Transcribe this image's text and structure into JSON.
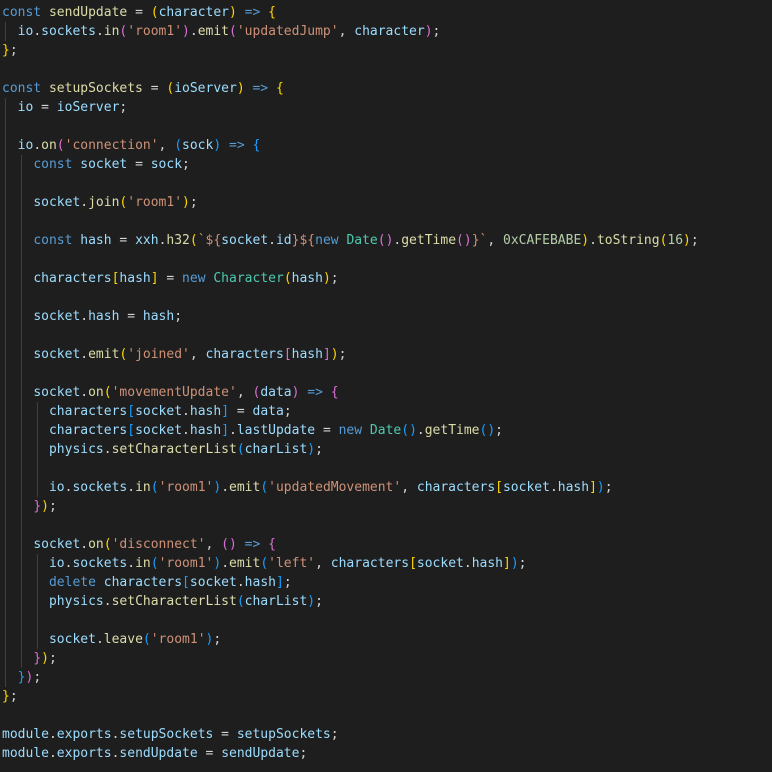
{
  "colors": {
    "background": "#1e1e1e",
    "text": "#d4d4d4",
    "keyword": "#569cd6",
    "function": "#dcdcaa",
    "variable": "#9cdcfe",
    "string": "#ce9178",
    "number": "#b5cea8",
    "class": "#4ec9b0",
    "control": "#c586c0",
    "bracket1": "#ffd700",
    "bracket2": "#da70d6",
    "bracket3": "#179fff"
  },
  "code": {
    "lines": [
      [
        [
          "kw",
          "const"
        ],
        [
          "p",
          " "
        ],
        [
          "def",
          "sendUpdate"
        ],
        [
          "p",
          " = "
        ],
        [
          "b1",
          "("
        ],
        [
          "var",
          "character"
        ],
        [
          "b1",
          ")"
        ],
        [
          "p",
          " "
        ],
        [
          "kw",
          "=>"
        ],
        [
          "p",
          " "
        ],
        [
          "b1",
          "{"
        ]
      ],
      [
        [
          "p",
          "  "
        ],
        [
          "var",
          "io"
        ],
        [
          "p",
          "."
        ],
        [
          "var",
          "sockets"
        ],
        [
          "p",
          "."
        ],
        [
          "def",
          "in"
        ],
        [
          "b2",
          "("
        ],
        [
          "str",
          "'room1'"
        ],
        [
          "b2",
          ")"
        ],
        [
          "p",
          "."
        ],
        [
          "def",
          "emit"
        ],
        [
          "b2",
          "("
        ],
        [
          "str",
          "'updatedJump'"
        ],
        [
          "p",
          ", "
        ],
        [
          "var",
          "character"
        ],
        [
          "b2",
          ")"
        ],
        [
          "p",
          ";"
        ]
      ],
      [
        [
          "b1",
          "}"
        ],
        [
          "p",
          ";"
        ]
      ],
      [],
      [
        [
          "kw",
          "const"
        ],
        [
          "p",
          " "
        ],
        [
          "def",
          "setupSockets"
        ],
        [
          "p",
          " = "
        ],
        [
          "b1",
          "("
        ],
        [
          "var",
          "ioServer"
        ],
        [
          "b1",
          ")"
        ],
        [
          "p",
          " "
        ],
        [
          "kw",
          "=>"
        ],
        [
          "p",
          " "
        ],
        [
          "b1",
          "{"
        ]
      ],
      [
        [
          "p",
          "  "
        ],
        [
          "var",
          "io"
        ],
        [
          "p",
          " = "
        ],
        [
          "var",
          "ioServer"
        ],
        [
          "p",
          ";"
        ]
      ],
      [],
      [
        [
          "p",
          "  "
        ],
        [
          "var",
          "io"
        ],
        [
          "p",
          "."
        ],
        [
          "def",
          "on"
        ],
        [
          "b2",
          "("
        ],
        [
          "str",
          "'connection'"
        ],
        [
          "p",
          ", "
        ],
        [
          "b3",
          "("
        ],
        [
          "var",
          "sock"
        ],
        [
          "b3",
          ")"
        ],
        [
          "p",
          " "
        ],
        [
          "kw",
          "=>"
        ],
        [
          "p",
          " "
        ],
        [
          "b3",
          "{"
        ]
      ],
      [
        [
          "p",
          "    "
        ],
        [
          "kw",
          "const"
        ],
        [
          "p",
          " "
        ],
        [
          "var",
          "socket"
        ],
        [
          "p",
          " = "
        ],
        [
          "var",
          "sock"
        ],
        [
          "p",
          ";"
        ]
      ],
      [],
      [
        [
          "p",
          "    "
        ],
        [
          "var",
          "socket"
        ],
        [
          "p",
          "."
        ],
        [
          "def",
          "join"
        ],
        [
          "b1",
          "("
        ],
        [
          "str",
          "'room1'"
        ],
        [
          "b1",
          ")"
        ],
        [
          "p",
          ";"
        ]
      ],
      [],
      [
        [
          "p",
          "    "
        ],
        [
          "kw",
          "const"
        ],
        [
          "p",
          " "
        ],
        [
          "var",
          "hash"
        ],
        [
          "p",
          " = "
        ],
        [
          "var",
          "xxh"
        ],
        [
          "p",
          "."
        ],
        [
          "def",
          "h32"
        ],
        [
          "b1",
          "("
        ],
        [
          "str",
          "`${"
        ],
        [
          "var",
          "socket"
        ],
        [
          "p",
          "."
        ],
        [
          "var",
          "id"
        ],
        [
          "str",
          "}${"
        ],
        [
          "kw",
          "new"
        ],
        [
          "p",
          " "
        ],
        [
          "cls",
          "Date"
        ],
        [
          "b2",
          "("
        ],
        [
          "b2",
          ")"
        ],
        [
          "p",
          "."
        ],
        [
          "def",
          "getTime"
        ],
        [
          "b2",
          "("
        ],
        [
          "b2",
          ")"
        ],
        [
          "str",
          "}`"
        ],
        [
          "p",
          ", "
        ],
        [
          "num",
          "0xCAFEBABE"
        ],
        [
          "b1",
          ")"
        ],
        [
          "p",
          "."
        ],
        [
          "def",
          "toString"
        ],
        [
          "b1",
          "("
        ],
        [
          "num",
          "16"
        ],
        [
          "b1",
          ")"
        ],
        [
          "p",
          ";"
        ]
      ],
      [],
      [
        [
          "p",
          "    "
        ],
        [
          "var",
          "characters"
        ],
        [
          "b1",
          "["
        ],
        [
          "var",
          "hash"
        ],
        [
          "b1",
          "]"
        ],
        [
          "p",
          " = "
        ],
        [
          "kw",
          "new"
        ],
        [
          "p",
          " "
        ],
        [
          "cls",
          "Character"
        ],
        [
          "b1",
          "("
        ],
        [
          "var",
          "hash"
        ],
        [
          "b1",
          ")"
        ],
        [
          "p",
          ";"
        ]
      ],
      [],
      [
        [
          "p",
          "    "
        ],
        [
          "var",
          "socket"
        ],
        [
          "p",
          "."
        ],
        [
          "var",
          "hash"
        ],
        [
          "p",
          " = "
        ],
        [
          "var",
          "hash"
        ],
        [
          "p",
          ";"
        ]
      ],
      [],
      [
        [
          "p",
          "    "
        ],
        [
          "var",
          "socket"
        ],
        [
          "p",
          "."
        ],
        [
          "def",
          "emit"
        ],
        [
          "b1",
          "("
        ],
        [
          "str",
          "'joined'"
        ],
        [
          "p",
          ", "
        ],
        [
          "var",
          "characters"
        ],
        [
          "b2",
          "["
        ],
        [
          "var",
          "hash"
        ],
        [
          "b2",
          "]"
        ],
        [
          "b1",
          ")"
        ],
        [
          "p",
          ";"
        ]
      ],
      [],
      [
        [
          "p",
          "    "
        ],
        [
          "var",
          "socket"
        ],
        [
          "p",
          "."
        ],
        [
          "def",
          "on"
        ],
        [
          "b1",
          "("
        ],
        [
          "str",
          "'movementUpdate'"
        ],
        [
          "p",
          ", "
        ],
        [
          "b2",
          "("
        ],
        [
          "var",
          "data"
        ],
        [
          "b2",
          ")"
        ],
        [
          "p",
          " "
        ],
        [
          "kw",
          "=>"
        ],
        [
          "p",
          " "
        ],
        [
          "b2",
          "{"
        ]
      ],
      [
        [
          "p",
          "      "
        ],
        [
          "var",
          "characters"
        ],
        [
          "b3",
          "["
        ],
        [
          "var",
          "socket"
        ],
        [
          "p",
          "."
        ],
        [
          "var",
          "hash"
        ],
        [
          "b3",
          "]"
        ],
        [
          "p",
          " = "
        ],
        [
          "var",
          "data"
        ],
        [
          "p",
          ";"
        ]
      ],
      [
        [
          "p",
          "      "
        ],
        [
          "var",
          "characters"
        ],
        [
          "b3",
          "["
        ],
        [
          "var",
          "socket"
        ],
        [
          "p",
          "."
        ],
        [
          "var",
          "hash"
        ],
        [
          "b3",
          "]"
        ],
        [
          "p",
          "."
        ],
        [
          "var",
          "lastUpdate"
        ],
        [
          "p",
          " = "
        ],
        [
          "kw",
          "new"
        ],
        [
          "p",
          " "
        ],
        [
          "cls",
          "Date"
        ],
        [
          "b3",
          "("
        ],
        [
          "b3",
          ")"
        ],
        [
          "p",
          "."
        ],
        [
          "def",
          "getTime"
        ],
        [
          "b3",
          "("
        ],
        [
          "b3",
          ")"
        ],
        [
          "p",
          ";"
        ]
      ],
      [
        [
          "p",
          "      "
        ],
        [
          "var",
          "physics"
        ],
        [
          "p",
          "."
        ],
        [
          "def",
          "setCharacterList"
        ],
        [
          "b3",
          "("
        ],
        [
          "var",
          "charList"
        ],
        [
          "b3",
          ")"
        ],
        [
          "p",
          ";"
        ]
      ],
      [],
      [
        [
          "p",
          "      "
        ],
        [
          "var",
          "io"
        ],
        [
          "p",
          "."
        ],
        [
          "var",
          "sockets"
        ],
        [
          "p",
          "."
        ],
        [
          "def",
          "in"
        ],
        [
          "b3",
          "("
        ],
        [
          "str",
          "'room1'"
        ],
        [
          "b3",
          ")"
        ],
        [
          "p",
          "."
        ],
        [
          "def",
          "emit"
        ],
        [
          "b3",
          "("
        ],
        [
          "str",
          "'updatedMovement'"
        ],
        [
          "p",
          ", "
        ],
        [
          "var",
          "characters"
        ],
        [
          "b1",
          "["
        ],
        [
          "var",
          "socket"
        ],
        [
          "p",
          "."
        ],
        [
          "var",
          "hash"
        ],
        [
          "b1",
          "]"
        ],
        [
          "b3",
          ")"
        ],
        [
          "p",
          ";"
        ]
      ],
      [
        [
          "p",
          "    "
        ],
        [
          "b2",
          "}"
        ],
        [
          "b1",
          ")"
        ],
        [
          "p",
          ";"
        ]
      ],
      [],
      [
        [
          "p",
          "    "
        ],
        [
          "var",
          "socket"
        ],
        [
          "p",
          "."
        ],
        [
          "def",
          "on"
        ],
        [
          "b1",
          "("
        ],
        [
          "str",
          "'disconnect'"
        ],
        [
          "p",
          ", "
        ],
        [
          "b2",
          "("
        ],
        [
          "b2",
          ")"
        ],
        [
          "p",
          " "
        ],
        [
          "kw",
          "=>"
        ],
        [
          "p",
          " "
        ],
        [
          "b2",
          "{"
        ]
      ],
      [
        [
          "p",
          "      "
        ],
        [
          "var",
          "io"
        ],
        [
          "p",
          "."
        ],
        [
          "var",
          "sockets"
        ],
        [
          "p",
          "."
        ],
        [
          "def",
          "in"
        ],
        [
          "b3",
          "("
        ],
        [
          "str",
          "'room1'"
        ],
        [
          "b3",
          ")"
        ],
        [
          "p",
          "."
        ],
        [
          "def",
          "emit"
        ],
        [
          "b3",
          "("
        ],
        [
          "str",
          "'left'"
        ],
        [
          "p",
          ", "
        ],
        [
          "var",
          "characters"
        ],
        [
          "b1",
          "["
        ],
        [
          "var",
          "socket"
        ],
        [
          "p",
          "."
        ],
        [
          "var",
          "hash"
        ],
        [
          "b1",
          "]"
        ],
        [
          "b3",
          ")"
        ],
        [
          "p",
          ";"
        ]
      ],
      [
        [
          "p",
          "      "
        ],
        [
          "kw",
          "delete"
        ],
        [
          "p",
          " "
        ],
        [
          "var",
          "characters"
        ],
        [
          "b3",
          "["
        ],
        [
          "var",
          "socket"
        ],
        [
          "p",
          "."
        ],
        [
          "var",
          "hash"
        ],
        [
          "b3",
          "]"
        ],
        [
          "p",
          ";"
        ]
      ],
      [
        [
          "p",
          "      "
        ],
        [
          "var",
          "physics"
        ],
        [
          "p",
          "."
        ],
        [
          "def",
          "setCharacterList"
        ],
        [
          "b3",
          "("
        ],
        [
          "var",
          "charList"
        ],
        [
          "b3",
          ")"
        ],
        [
          "p",
          ";"
        ]
      ],
      [],
      [
        [
          "p",
          "      "
        ],
        [
          "var",
          "socket"
        ],
        [
          "p",
          "."
        ],
        [
          "def",
          "leave"
        ],
        [
          "b3",
          "("
        ],
        [
          "str",
          "'room1'"
        ],
        [
          "b3",
          ")"
        ],
        [
          "p",
          ";"
        ]
      ],
      [
        [
          "p",
          "    "
        ],
        [
          "b2",
          "}"
        ],
        [
          "b1",
          ")"
        ],
        [
          "p",
          ";"
        ]
      ],
      [
        [
          "p",
          "  "
        ],
        [
          "b3",
          "}"
        ],
        [
          "b2",
          ")"
        ],
        [
          "p",
          ";"
        ]
      ],
      [
        [
          "b1",
          "}"
        ],
        [
          "p",
          ";"
        ]
      ],
      [],
      [
        [
          "var",
          "module"
        ],
        [
          "p",
          "."
        ],
        [
          "var",
          "exports"
        ],
        [
          "p",
          "."
        ],
        [
          "var",
          "setupSockets"
        ],
        [
          "p",
          " = "
        ],
        [
          "var",
          "setupSockets"
        ],
        [
          "p",
          ";"
        ]
      ],
      [
        [
          "var",
          "module"
        ],
        [
          "p",
          "."
        ],
        [
          "var",
          "exports"
        ],
        [
          "p",
          "."
        ],
        [
          "var",
          "sendUpdate"
        ],
        [
          "p",
          " = "
        ],
        [
          "var",
          "sendUpdate"
        ],
        [
          "p",
          ";"
        ]
      ]
    ]
  }
}
